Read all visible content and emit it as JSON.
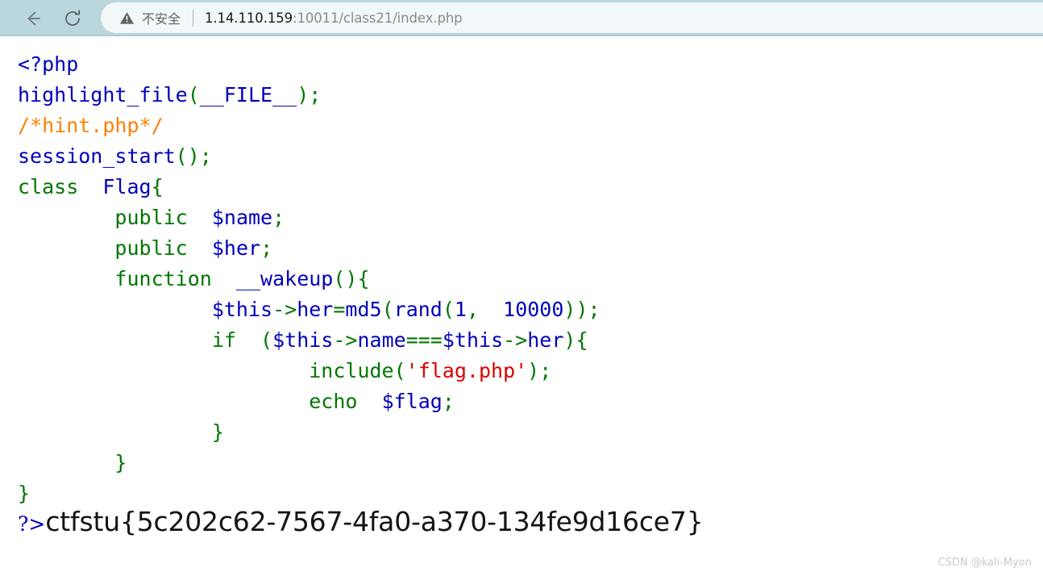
{
  "browser": {
    "back_label": "Back",
    "reload_label": "Reload",
    "back_icon": "arrow-left-icon",
    "reload_icon": "reload-icon",
    "security": {
      "icon": "warning-triangle-icon",
      "label": "不安全"
    },
    "url": {
      "host": "1.14.110.159",
      "rest": ":10011/class21/index.php",
      "full": "1.14.110.159:10011/class21/index.php"
    }
  },
  "colors": {
    "toolbar_bg": "#b9d7dc",
    "omnibox_bg": "#f2f8f8",
    "php_default": "#0000BB",
    "php_keyword": "#007700",
    "php_comment": "#FF8000",
    "php_string": "#DD0000",
    "page_bg": "#ffffff",
    "watermark": "#c9c9c9"
  },
  "code": {
    "language": "php",
    "lines": [
      {
        "n": 1,
        "tokens": [
          {
            "t": "<?php",
            "c": "default"
          }
        ]
      },
      {
        "n": 2,
        "tokens": [
          {
            "t": "highlight_file",
            "c": "default"
          },
          {
            "t": "(",
            "c": "keyword"
          },
          {
            "t": "__FILE__",
            "c": "default"
          },
          {
            "t": ")",
            "c": "keyword"
          },
          {
            "t": ";",
            "c": "keyword"
          }
        ]
      },
      {
        "n": 3,
        "tokens": [
          {
            "t": "/*hint.php*/",
            "c": "comment"
          }
        ]
      },
      {
        "n": 4,
        "tokens": [
          {
            "t": "session_start",
            "c": "default"
          },
          {
            "t": "();",
            "c": "keyword"
          }
        ]
      },
      {
        "n": 5,
        "tokens": [
          {
            "t": "class",
            "c": "keyword"
          },
          {
            "t": "  ",
            "c": "plain"
          },
          {
            "t": "Flag",
            "c": "default"
          },
          {
            "t": "{",
            "c": "keyword"
          }
        ]
      },
      {
        "n": 6,
        "tokens": [
          {
            "t": "        ",
            "c": "plain"
          },
          {
            "t": "public",
            "c": "keyword"
          },
          {
            "t": "  ",
            "c": "plain"
          },
          {
            "t": "$name",
            "c": "default"
          },
          {
            "t": ";",
            "c": "keyword"
          }
        ]
      },
      {
        "n": 7,
        "tokens": [
          {
            "t": "        ",
            "c": "plain"
          },
          {
            "t": "public",
            "c": "keyword"
          },
          {
            "t": "  ",
            "c": "plain"
          },
          {
            "t": "$her",
            "c": "default"
          },
          {
            "t": ";",
            "c": "keyword"
          }
        ]
      },
      {
        "n": 8,
        "tokens": [
          {
            "t": "        ",
            "c": "plain"
          },
          {
            "t": "function",
            "c": "keyword"
          },
          {
            "t": "  ",
            "c": "plain"
          },
          {
            "t": "__wakeup",
            "c": "default"
          },
          {
            "t": "()",
            "c": "keyword"
          },
          {
            "t": "{",
            "c": "keyword"
          }
        ]
      },
      {
        "n": 9,
        "tokens": [
          {
            "t": "                ",
            "c": "plain"
          },
          {
            "t": "$this",
            "c": "default"
          },
          {
            "t": "->",
            "c": "keyword"
          },
          {
            "t": "her",
            "c": "default"
          },
          {
            "t": "=",
            "c": "keyword"
          },
          {
            "t": "md5",
            "c": "default"
          },
          {
            "t": "(",
            "c": "keyword"
          },
          {
            "t": "rand",
            "c": "default"
          },
          {
            "t": "(",
            "c": "keyword"
          },
          {
            "t": "1",
            "c": "default"
          },
          {
            "t": ",  ",
            "c": "keyword"
          },
          {
            "t": "10000",
            "c": "default"
          },
          {
            "t": "));",
            "c": "keyword"
          }
        ]
      },
      {
        "n": 10,
        "tokens": [
          {
            "t": "                ",
            "c": "plain"
          },
          {
            "t": "if",
            "c": "keyword"
          },
          {
            "t": "  ",
            "c": "plain"
          },
          {
            "t": "(",
            "c": "keyword"
          },
          {
            "t": "$this",
            "c": "default"
          },
          {
            "t": "->",
            "c": "keyword"
          },
          {
            "t": "name",
            "c": "default"
          },
          {
            "t": "===",
            "c": "keyword"
          },
          {
            "t": "$this",
            "c": "default"
          },
          {
            "t": "->",
            "c": "keyword"
          },
          {
            "t": "her",
            "c": "default"
          },
          {
            "t": ")",
            "c": "keyword"
          },
          {
            "t": "{",
            "c": "keyword"
          }
        ]
      },
      {
        "n": 11,
        "tokens": [
          {
            "t": "                        ",
            "c": "plain"
          },
          {
            "t": "include",
            "c": "keyword"
          },
          {
            "t": "(",
            "c": "keyword"
          },
          {
            "t": "'flag.php'",
            "c": "string"
          },
          {
            "t": ");",
            "c": "keyword"
          }
        ]
      },
      {
        "n": 12,
        "tokens": [
          {
            "t": "                        ",
            "c": "plain"
          },
          {
            "t": "echo",
            "c": "keyword"
          },
          {
            "t": "  ",
            "c": "plain"
          },
          {
            "t": "$flag",
            "c": "default"
          },
          {
            "t": ";",
            "c": "keyword"
          }
        ]
      },
      {
        "n": 13,
        "tokens": [
          {
            "t": "                ",
            "c": "plain"
          },
          {
            "t": "}",
            "c": "keyword"
          }
        ]
      },
      {
        "n": 14,
        "tokens": [
          {
            "t": "        ",
            "c": "plain"
          },
          {
            "t": "}",
            "c": "keyword"
          }
        ]
      },
      {
        "n": 15,
        "tokens": [
          {
            "t": "}",
            "c": "keyword"
          }
        ]
      }
    ],
    "closing_tag": "?>"
  },
  "output": {
    "flag": "ctfstu{5c202c62-7567-4fa0-a370-134fe9d16ce7}"
  },
  "watermark": {
    "text": "CSDN @kali-Myon"
  }
}
